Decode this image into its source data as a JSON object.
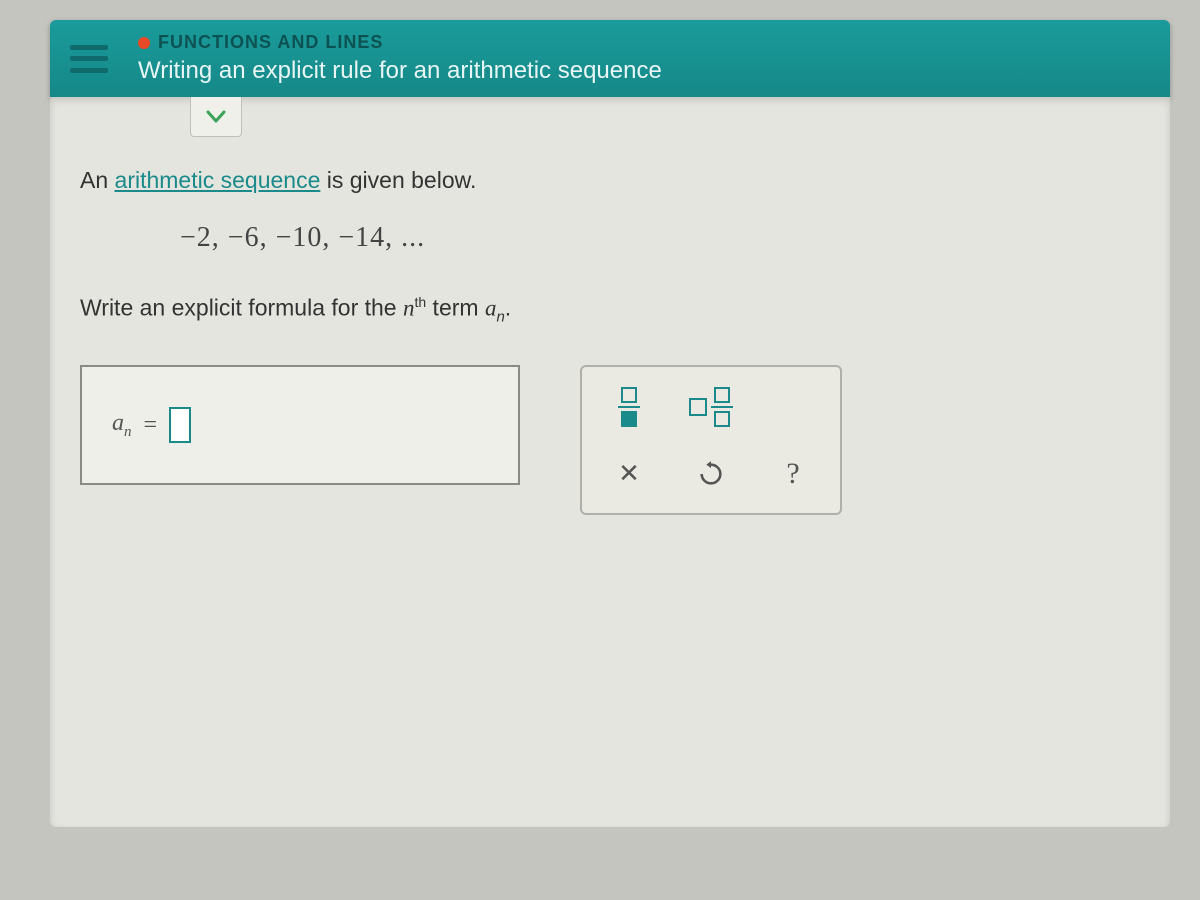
{
  "header": {
    "category": "FUNCTIONS AND LINES",
    "title": "Writing an explicit rule for an arithmetic sequence"
  },
  "problem": {
    "intro_prefix": "An ",
    "intro_link": "arithmetic sequence",
    "intro_suffix": " is given below.",
    "sequence": "−2,  −6,  −10,  −14,  ...",
    "instruction_prefix": "Write an explicit formula for the ",
    "instruction_var": "n",
    "instruction_sup": "th",
    "instruction_mid": " term ",
    "instruction_a": "a",
    "instruction_sub": "n",
    "instruction_end": "."
  },
  "answer": {
    "lhs_a": "a",
    "lhs_sub": "n",
    "equals": "="
  },
  "icons": {
    "menu": "menu-icon",
    "status_check": "✓",
    "fraction": "fraction-tool",
    "mixed": "mixed-number-tool",
    "clear": "✕",
    "reset": "reset-tool",
    "help": "?"
  }
}
